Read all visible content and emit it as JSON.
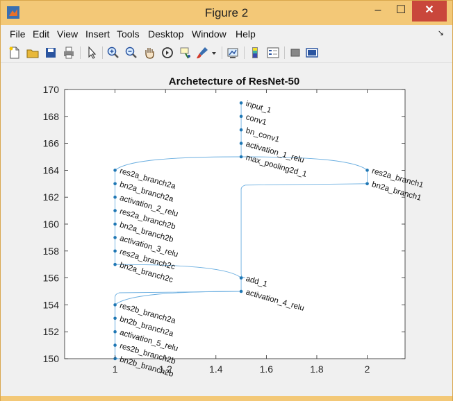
{
  "window": {
    "title": "Figure 2",
    "minimize_label": "–",
    "maximize_label": "☐",
    "close_label": "✕"
  },
  "menu": {
    "items": [
      "File",
      "Edit",
      "View",
      "Insert",
      "Tools",
      "Desktop",
      "Window",
      "Help"
    ],
    "overflow_arrow": "↘"
  },
  "toolbar": {
    "icons": [
      "new-figure-icon",
      "open-file-icon",
      "save-icon",
      "print-icon",
      "pointer-icon",
      "zoom-in-icon",
      "zoom-out-icon",
      "pan-hand-icon",
      "rotate-3d-icon",
      "data-cursor-icon",
      "brush-icon",
      "brush-dropdown-icon",
      "link-plot-icon",
      "colorbar-icon",
      "legend-icon",
      "hide-plot-tools-icon",
      "show-plot-tools-icon"
    ]
  },
  "chart_data": {
    "type": "graph",
    "title": "Archetecture of ResNet-50",
    "xlim": [
      0.8,
      2.15
    ],
    "ylim": [
      150,
      170
    ],
    "xticks": [
      "1",
      "1.2",
      "1.4",
      "1.6",
      "1.8",
      "2"
    ],
    "yticks": [
      "150",
      "152",
      "154",
      "156",
      "158",
      "160",
      "162",
      "164",
      "166",
      "168",
      "170"
    ],
    "node_color": "#1f77b4",
    "edge_color": "#6aaee0",
    "nodes": [
      {
        "name": "input_1",
        "x": 1.5,
        "y": 169
      },
      {
        "name": "conv1",
        "x": 1.5,
        "y": 168
      },
      {
        "name": "bn_conv1",
        "x": 1.5,
        "y": 167
      },
      {
        "name": "activation_1_relu",
        "x": 1.5,
        "y": 166
      },
      {
        "name": "max_pooling2d_1",
        "x": 1.5,
        "y": 165
      },
      {
        "name": "res2a_branch2a",
        "x": 1,
        "y": 164
      },
      {
        "name": "bn2a_branch2a",
        "x": 1,
        "y": 163
      },
      {
        "name": "activation_2_relu",
        "x": 1,
        "y": 162
      },
      {
        "name": "res2a_branch2b",
        "x": 1,
        "y": 161
      },
      {
        "name": "bn2a_branch2b",
        "x": 1,
        "y": 160
      },
      {
        "name": "activation_3_relu",
        "x": 1,
        "y": 159
      },
      {
        "name": "res2a_branch2c",
        "x": 1,
        "y": 158
      },
      {
        "name": "bn2a_branch2c",
        "x": 1,
        "y": 157
      },
      {
        "name": "res2a_branch1",
        "x": 2,
        "y": 164
      },
      {
        "name": "bn2a_branch1",
        "x": 2,
        "y": 163
      },
      {
        "name": "add_1",
        "x": 1.5,
        "y": 156
      },
      {
        "name": "activation_4_relu",
        "x": 1.5,
        "y": 155
      },
      {
        "name": "res2b_branch2a",
        "x": 1,
        "y": 154
      },
      {
        "name": "bn2b_branch2a",
        "x": 1,
        "y": 153
      },
      {
        "name": "activation_5_relu",
        "x": 1,
        "y": 152
      },
      {
        "name": "res2b_branch2b",
        "x": 1,
        "y": 151
      },
      {
        "name": "bn2b_branch2b",
        "x": 1,
        "y": 150
      }
    ],
    "edges": [
      [
        "input_1",
        "conv1"
      ],
      [
        "conv1",
        "bn_conv1"
      ],
      [
        "bn_conv1",
        "activation_1_relu"
      ],
      [
        "activation_1_relu",
        "max_pooling2d_1"
      ],
      [
        "max_pooling2d_1",
        "res2a_branch2a"
      ],
      [
        "max_pooling2d_1",
        "res2a_branch1"
      ],
      [
        "res2a_branch2a",
        "bn2a_branch2a"
      ],
      [
        "bn2a_branch2a",
        "activation_2_relu"
      ],
      [
        "activation_2_relu",
        "res2a_branch2b"
      ],
      [
        "res2a_branch2b",
        "bn2a_branch2b"
      ],
      [
        "bn2a_branch2b",
        "activation_3_relu"
      ],
      [
        "activation_3_relu",
        "res2a_branch2c"
      ],
      [
        "res2a_branch2c",
        "bn2a_branch2c"
      ],
      [
        "res2a_branch1",
        "bn2a_branch1"
      ],
      [
        "bn2a_branch2c",
        "add_1"
      ],
      [
        "bn2a_branch1",
        "add_1"
      ],
      [
        "add_1",
        "activation_4_relu"
      ],
      [
        "activation_4_relu",
        "res2b_branch2a"
      ],
      [
        "activation_4_relu",
        "bn2b_branch2b"
      ],
      [
        "res2b_branch2a",
        "bn2b_branch2a"
      ],
      [
        "bn2b_branch2a",
        "activation_5_relu"
      ],
      [
        "activation_5_relu",
        "res2b_branch2b"
      ],
      [
        "res2b_branch2b",
        "bn2b_branch2b"
      ]
    ]
  }
}
